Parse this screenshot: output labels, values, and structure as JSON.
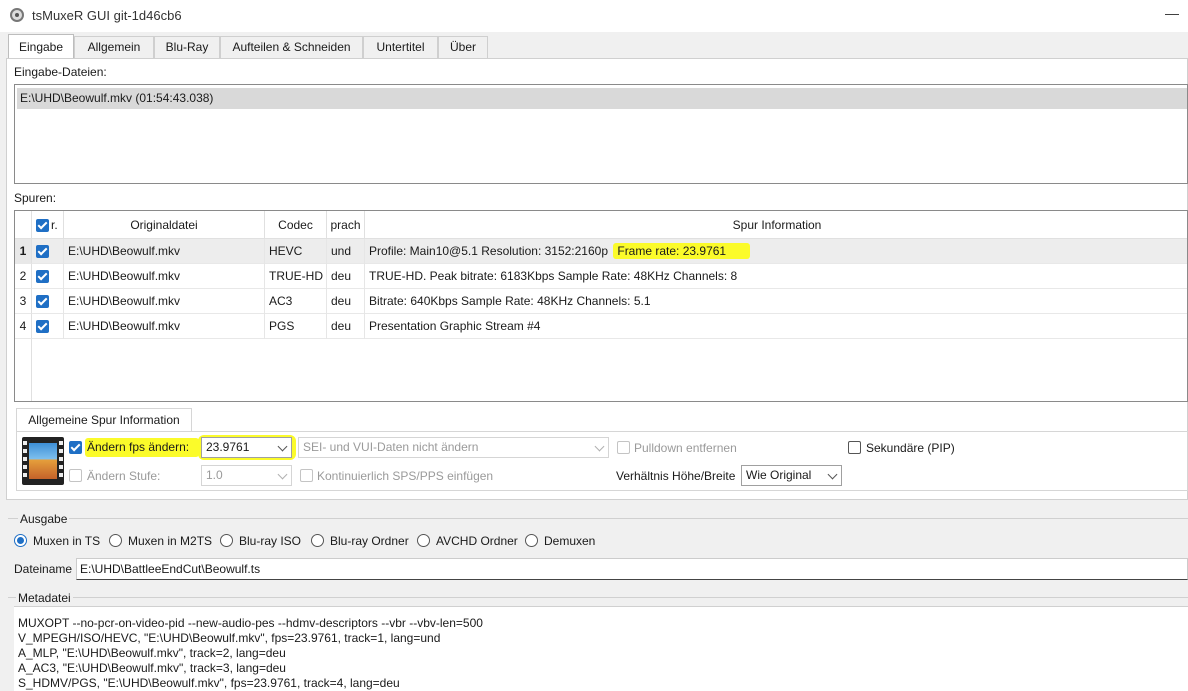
{
  "window": {
    "title": "tsMuxeR GUI git-1d46cb6",
    "minimize": "—"
  },
  "tabs": [
    "Eingabe",
    "Allgemein",
    "Blu-Ray",
    "Aufteilen & Schneiden",
    "Untertitel",
    "Über"
  ],
  "input": {
    "files_label": "Eingabe-Dateien:",
    "files": [
      "E:\\UHD\\Beowulf.mkv (01:54:43.038)"
    ]
  },
  "tracks": {
    "label": "Spuren:",
    "headers": {
      "enabled": "r.",
      "file": "Originaldatei",
      "codec": "Codec",
      "lang": "prach",
      "info": "Spur Information"
    },
    "rows": [
      {
        "num": "1",
        "checked": true,
        "file": "E:\\UHD\\Beowulf.mkv",
        "codec": "HEVC",
        "lang": "und",
        "info": "Profile: Main10@5.1 Resolution: 3152:2160p",
        "info_highlight": "Frame rate: 23.9761"
      },
      {
        "num": "2",
        "checked": true,
        "file": "E:\\UHD\\Beowulf.mkv",
        "codec": "TRUE-HD",
        "lang": "deu",
        "info": "TRUE-HD. Peak bitrate: 6183Kbps Sample Rate: 48KHz Channels: 8",
        "info_highlight": ""
      },
      {
        "num": "3",
        "checked": true,
        "file": "E:\\UHD\\Beowulf.mkv",
        "codec": "AC3",
        "lang": "deu",
        "info": "Bitrate: 640Kbps Sample Rate: 48KHz Channels: 5.1",
        "info_highlight": ""
      },
      {
        "num": "4",
        "checked": true,
        "file": "E:\\UHD\\Beowulf.mkv",
        "codec": "PGS",
        "lang": "deu",
        "info": "Presentation Graphic Stream #4",
        "info_highlight": ""
      }
    ]
  },
  "general_track": {
    "tab": "Allgemeine Spur Information",
    "change_fps_label": "Ändern fps ändern:",
    "change_fps_checked": true,
    "fps_value": "23.9761",
    "sei_select": "SEI- und VUI-Daten nicht ändern",
    "pulldown_label": "Pulldown entfernen",
    "secondary_label": "Sekundäre (PIP)",
    "change_level_label": "Ändern Stufe:",
    "level_value": "1.0",
    "continuous_sps_label": "Kontinuierlich SPS/PPS einfügen",
    "aspect_label": "Verhältnis Höhe/Breite",
    "aspect_value": "Wie Original"
  },
  "output": {
    "label": "Ausgabe",
    "modes": [
      "Muxen in TS",
      "Muxen in M2TS",
      "Blu-ray ISO",
      "Blu-ray Ordner",
      "AVCHD Ordner",
      "Demuxen"
    ],
    "selected_mode": "Muxen in TS",
    "filename_label": "Dateiname",
    "filename": "E:\\UHD\\BattleeEndCut\\Beowulf.ts"
  },
  "metadata": {
    "label": "Metadatei",
    "lines": [
      "MUXOPT --no-pcr-on-video-pid --new-audio-pes --hdmv-descriptors --vbr  --vbv-len=500",
      "V_MPEGH/ISO/HEVC, \"E:\\UHD\\Beowulf.mkv\", fps=23.9761, track=1, lang=und",
      "A_MLP, \"E:\\UHD\\Beowulf.mkv\", track=2, lang=deu",
      "A_AC3, \"E:\\UHD\\Beowulf.mkv\", track=3, lang=deu",
      "S_HDMV/PGS, \"E:\\UHD\\Beowulf.mkv\", fps=23.9761, track=4, lang=deu"
    ]
  },
  "colors": {
    "accent": "#1f6fc5",
    "highlight": "#fbfb2a",
    "selected_row": "#d9d9d9"
  }
}
